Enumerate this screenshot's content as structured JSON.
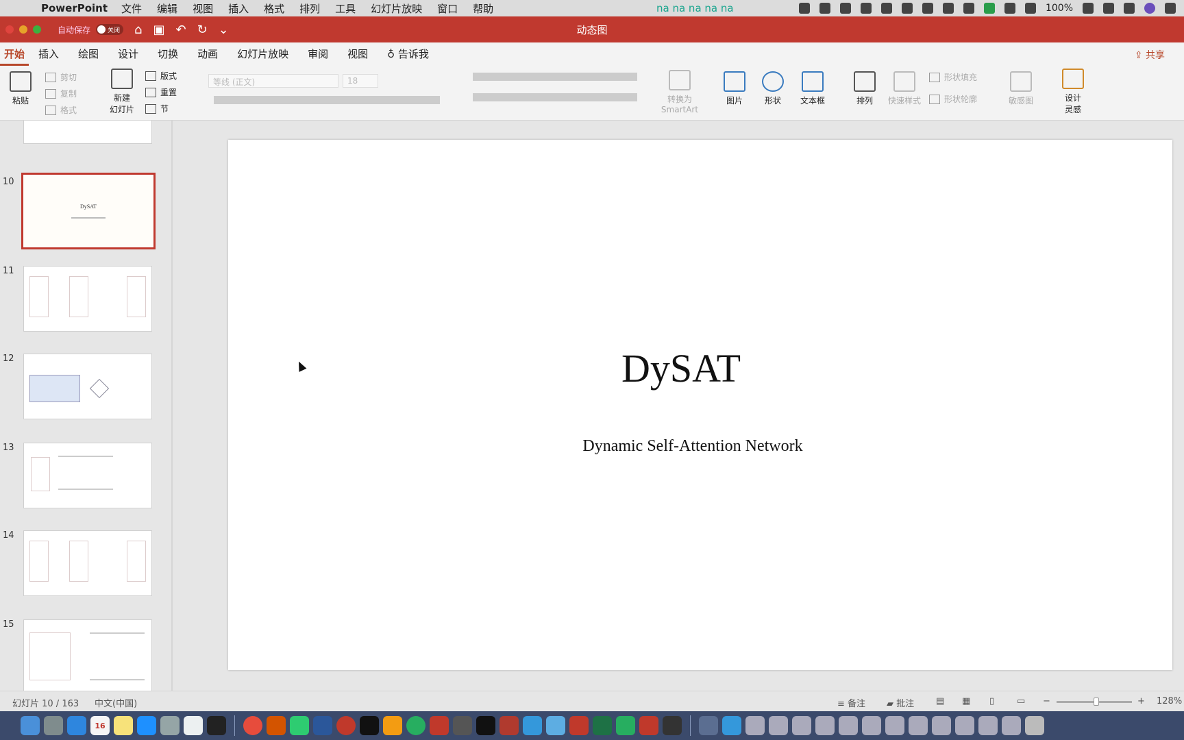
{
  "menubar": {
    "app_name": "PowerPoint",
    "items": [
      "文件",
      "编辑",
      "视图",
      "插入",
      "格式",
      "排列",
      "工具",
      "幻灯片放映",
      "窗口",
      "帮助"
    ],
    "lyrics": "na na na na na",
    "battery": "100%"
  },
  "titlebar": {
    "autosave_label": "自动保存",
    "toggle_label": "关闭",
    "document_title": "动态图"
  },
  "ribbon_tabs": {
    "tabs": [
      "开始",
      "插入",
      "绘图",
      "设计",
      "切换",
      "动画",
      "幻灯片放映",
      "审阅",
      "视图"
    ],
    "tell_me": "告诉我",
    "share": "共享"
  },
  "ribbon": {
    "paste": "粘贴",
    "cut": "剪切",
    "copy": "复制",
    "format": "格式",
    "new_slide_1": "新建",
    "new_slide_2": "幻灯片",
    "layout": "版式",
    "reset": "重置",
    "section": "节",
    "font_name": "等线 (正文)",
    "font_size": "18",
    "convert_smartart_1": "转换为",
    "convert_smartart_2": "SmartArt",
    "picture": "图片",
    "shapes": "形状",
    "textbox": "文本框",
    "arrange": "排列",
    "quick_styles": "快速样式",
    "shape_fill": "形状填充",
    "shape_outline": "形状轮廓",
    "sketch": "敏感图",
    "designer_1": "设计",
    "designer_2": "灵感"
  },
  "thumbnails": {
    "numbers": [
      "10",
      "11",
      "12",
      "13",
      "14",
      "15"
    ],
    "selected_title": "DySAT"
  },
  "slide": {
    "title": "DySAT",
    "subtitle": "Dynamic Self-Attention Network"
  },
  "statusbar": {
    "slide_counter": "幻灯片 10 / 163",
    "language": "中文(中国)",
    "notes": "备注",
    "comments": "批注",
    "zoom": "128%"
  },
  "colors": {
    "accent": "#c0392f",
    "tab_active": "#b7472a"
  },
  "dock": {
    "apps": [
      "finder",
      "launchpad",
      "safari",
      "calendar",
      "notes",
      "app-store",
      "system-preferences",
      "preview",
      "terminal",
      "chrome",
      "powerpoint",
      "wechat",
      "word",
      "netease-music",
      "pycharm",
      "sublime",
      "maps",
      "xmind",
      "zotero",
      "iterm",
      "filezilla",
      "feishu",
      "baidu-netdisk",
      "pdf-expert",
      "excel",
      "keynote",
      "youdao",
      "facetime"
    ],
    "calendar_day": "16"
  }
}
